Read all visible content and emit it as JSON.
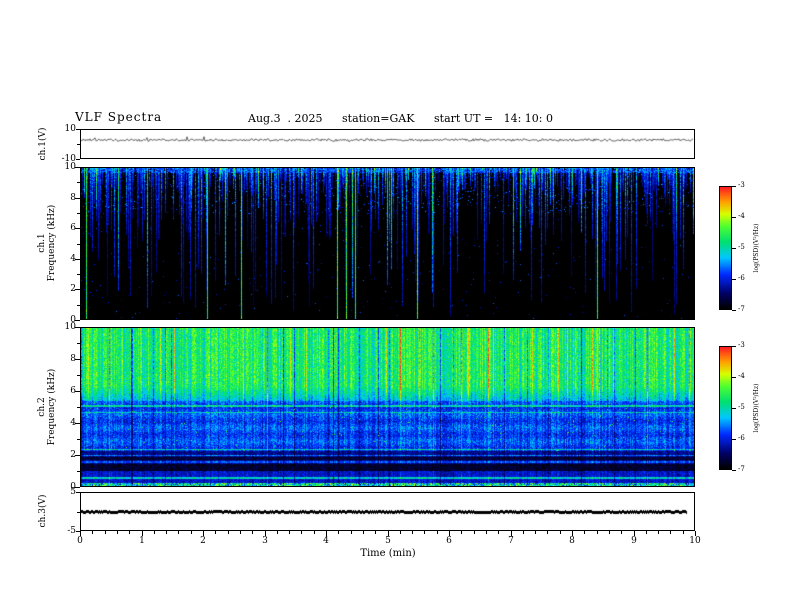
{
  "header": {
    "title": "VLF Spectra",
    "date": "Aug.3  . 2025",
    "station": "station=GAK",
    "start_ut": "start UT =   14: 10: 0"
  },
  "time_axis": {
    "label": "Time  (min)",
    "ticks": [
      "0",
      "1",
      "2",
      "3",
      "4",
      "5",
      "6",
      "7",
      "8",
      "9",
      "10"
    ],
    "range": [
      0,
      10
    ]
  },
  "panels": {
    "ch1_wave": {
      "name": "ch.1(V)",
      "ylim": [
        -10,
        10
      ],
      "ytick_values": [
        10,
        -10
      ],
      "ytick_labels": [
        "10",
        "-10"
      ]
    },
    "ch1_spec": {
      "name_line1": "ch.1",
      "name_line2": "Frequency (kHz)",
      "ylim": [
        0,
        10
      ],
      "ytick_values": [
        10,
        8,
        6,
        4,
        2,
        0
      ],
      "ytick_labels": [
        "10",
        "8",
        "6",
        "4",
        "2",
        "0"
      ]
    },
    "ch2_spec": {
      "name_line1": "ch.2",
      "name_line2": "Frequency (kHz)",
      "ylim": [
        0,
        10
      ],
      "ytick_values": [
        10,
        8,
        6,
        4,
        2,
        0
      ],
      "ytick_labels": [
        "10",
        "8",
        "6",
        "4",
        "2",
        "0"
      ]
    },
    "ch3_wave": {
      "name": "ch.3(V)",
      "ylim": [
        -5,
        5
      ],
      "ytick_values": [
        5,
        -5
      ],
      "ytick_labels": [
        "5",
        "-5"
      ]
    }
  },
  "colorbars": [
    {
      "label": "log(PSD)(V²/Hz)",
      "tick_labels": [
        "-3",
        "-4",
        "-5",
        "-6",
        "-7"
      ],
      "range": [
        -3,
        -7
      ]
    },
    {
      "label": "log(PSD)(V²/Hz)",
      "tick_labels": [
        "-3",
        "-4",
        "-5",
        "-6",
        "-7"
      ],
      "range": [
        -3,
        -7
      ]
    }
  ],
  "colormap": {
    "stops": [
      [
        0.0,
        "#000000"
      ],
      [
        0.12,
        "#000060"
      ],
      [
        0.28,
        "#0028ff"
      ],
      [
        0.42,
        "#00c8ff"
      ],
      [
        0.55,
        "#00e070"
      ],
      [
        0.68,
        "#50ff30"
      ],
      [
        0.78,
        "#d8ff00"
      ],
      [
        0.88,
        "#ffa000"
      ],
      [
        1.0,
        "#ff2020"
      ]
    ]
  },
  "chart_data": [
    {
      "type": "line",
      "panel": "ch.1(V) waveform",
      "xlim": [
        0,
        10
      ],
      "ylim": [
        -10,
        10
      ],
      "yticks": [
        10,
        -10
      ],
      "series": [
        {
          "name": "ch.1 voltage",
          "description": "nearly flat noisy trace around +3 V for the full 0-10 min record, jitter about ±1 V with sparse small spikes"
        }
      ]
    },
    {
      "type": "heatmap",
      "panel": "ch.1 spectrogram",
      "xlabel": "Time (min)",
      "ylabel": "Frequency (kHz)",
      "xlim": [
        0,
        10
      ],
      "ylim": [
        0,
        10
      ],
      "colorbar_label": "log(PSD)(V²/Hz)",
      "colorbar_range": [
        -7,
        -3
      ],
      "background_level": -7,
      "features": [
        "black (-7) background over most of the band below 6 kHz",
        "thin continuous weak blue band at 9.5-10 kHz",
        "dense narrow vertical impulsive streaks descending from 10 kHz, most terminating between 6 and 9 kHz",
        "occasional streaks reaching all the way to 0 kHz",
        "roughly a dozen brighter cyan-green full-band vertical lines spread across the record"
      ]
    },
    {
      "type": "heatmap",
      "panel": "ch.2 spectrogram",
      "xlabel": "Time (min)",
      "ylabel": "Frequency (kHz)",
      "xlim": [
        0,
        10
      ],
      "ylim": [
        0,
        10
      ],
      "colorbar_label": "log(PSD)(V²/Hz)",
      "colorbar_range": [
        -7,
        -3
      ],
      "features": [
        "broadband green-yellow level (-4.5 to -4) from 6 to 10 kHz with many orange-red vertical streaks near -3",
        "cyan horizontal lines near 5.0 and 4.6 kHz",
        "blue (-6 to -5.5) region 2-5 kHz with fine vertical striping and scattered green specks",
        "dark/black (-7) horizontal bands between about 0.9 and 2 kHz with cyan lines near 2.3, 1.9 and 1.5 kHz",
        "bright multicolored thin band below about 0.5 kHz"
      ]
    },
    {
      "type": "line",
      "panel": "ch.3(V) waveform",
      "xlim": [
        0,
        10
      ],
      "ylim": [
        -5,
        5
      ],
      "yticks": [
        5,
        -5
      ],
      "series": [
        {
          "name": "ch.3 voltage",
          "description": "constant 0 V thick flat trace ending near 9.85 min"
        }
      ]
    }
  ]
}
